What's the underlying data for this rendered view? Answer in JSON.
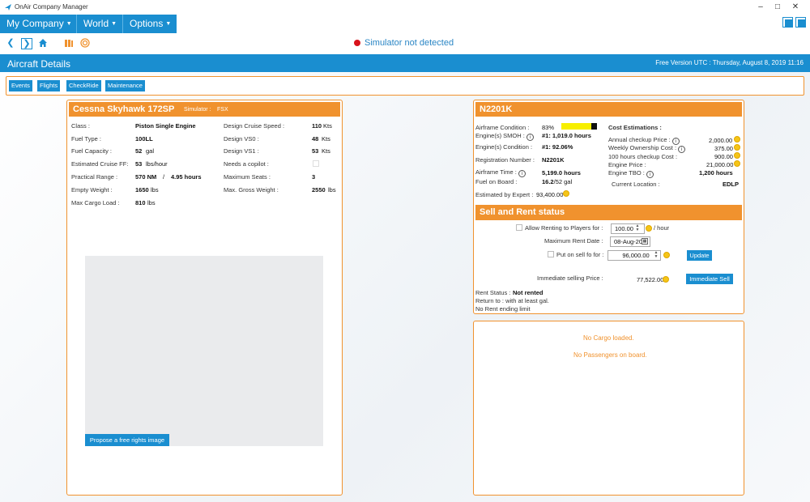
{
  "window": {
    "title": "OnAir Company Manager"
  },
  "menu": {
    "my_company": "My Company",
    "world": "World",
    "options": "Options"
  },
  "toolbar": {
    "simulator_status": "Simulator not detected"
  },
  "section": {
    "title": "Aircraft Details",
    "version_info": "Free Version  UTC : Thursday, August 8, 2019 11:16"
  },
  "tabs": [
    "Events",
    "Flights",
    "CheckRide",
    "Maintenance"
  ],
  "aircraft_type": {
    "name": "Cessna Skyhawk 172SP",
    "simulator_label": "Simulator :",
    "simulator": "FSX",
    "class_label": "Class :",
    "class": "Piston Single Engine",
    "fuel_type_label": "Fuel Type :",
    "fuel_type": "100LL",
    "fuel_capacity_label": "Fuel Capacity :",
    "fuel_capacity": "52",
    "fuel_capacity_unit": "gal",
    "cruise_ff_label": "Estimated Cruise FF:",
    "cruise_ff": "53",
    "cruise_ff_unit": "lbs/hour",
    "range_label": "Practical Range :",
    "range_nm": "570 NM",
    "range_sep": "/",
    "range_hours": "4.95 hours",
    "empty_weight_label": "Empty Weight :",
    "empty_weight": "1650",
    "empty_weight_unit": "lbs",
    "max_cargo_label": "Max Cargo Load :",
    "max_cargo": "810",
    "max_cargo_unit": "lbs",
    "cruise_speed_label": "Design Cruise Speed :",
    "cruise_speed": "110",
    "cruise_speed_unit": "Kts",
    "vs0_label": "Design VS0 :",
    "vs0": "48",
    "vs0_unit": "Kts",
    "vs1_label": "Design VS1 :",
    "vs1": "53",
    "vs1_unit": "Kts",
    "copilot_label": "Needs a copilot :",
    "max_seats_label": "Maximum Seats :",
    "max_seats": "3",
    "max_gross_label": "Max. Gross Weight :",
    "max_gross": "2550",
    "max_gross_unit": "lbs",
    "image_button": "Propose a free rights image"
  },
  "aircraft": {
    "registration": "N2201K",
    "airframe_condition_label": "Airframe Condition :",
    "airframe_condition": "83%",
    "airframe_condition_fraction": 0.83,
    "engine_smoh_label": "Engine(s) SMOH :",
    "engine_smoh": "#1: 1,019.0 hours",
    "engine_condition_label": "Engine(s) Condition :",
    "engine_condition": "#1: 92.06%",
    "registration_label": "Registration Number :",
    "airframe_time_label": "Airframe Time :",
    "airframe_time": "5,199.0 hours",
    "fuel_label": "Fuel on Board :",
    "fuel_value": "16.2",
    "fuel_capacity": "/52 gal",
    "estimated_label": "Estimated by Expert :",
    "estimated_value": "93,400.00",
    "cost_title": "Cost Estimations :",
    "costs": [
      {
        "label": "Annual checkup Price :",
        "value": "2,000.00",
        "info": true
      },
      {
        "label": "Weekly Ownership Cost :",
        "value": "375.00",
        "info": true
      },
      {
        "label": "100 hours checkup Cost :",
        "value": "900.00",
        "info": false
      },
      {
        "label": "Engine Price :",
        "value": "21,000.00",
        "info": false
      }
    ],
    "engine_tbo_label": "Engine TBO :",
    "engine_tbo": "1,200 hours",
    "location_label": "Current Location :",
    "location": "EDLP"
  },
  "sell_rent": {
    "title": "Sell and Rent status",
    "rent_label": "Allow Renting to Players for :",
    "rent_value": "100.00",
    "rent_unit": "/ hour",
    "max_rent_date_label": "Maximum Rent Date :",
    "max_rent_date": "08-Aug-20",
    "sell_label": "Put on sell fo for :",
    "sell_value": "96,000.00",
    "update_button": "Update",
    "immediate_label": "Immediate selling Price :",
    "immediate_value": "77,522.00",
    "immediate_button": "Immediate Sell",
    "rent_status_label": "Rent Status :",
    "rent_status": "Not rented",
    "return_line": "Return to :   with at least   gal.",
    "rent_limit": "No Rent ending limit"
  },
  "cargo": {
    "no_cargo": "No Cargo loaded.",
    "no_passengers": "No Passengers on board."
  },
  "colors": {
    "accent": "#1a8ed0",
    "orange": "#f0922e"
  }
}
